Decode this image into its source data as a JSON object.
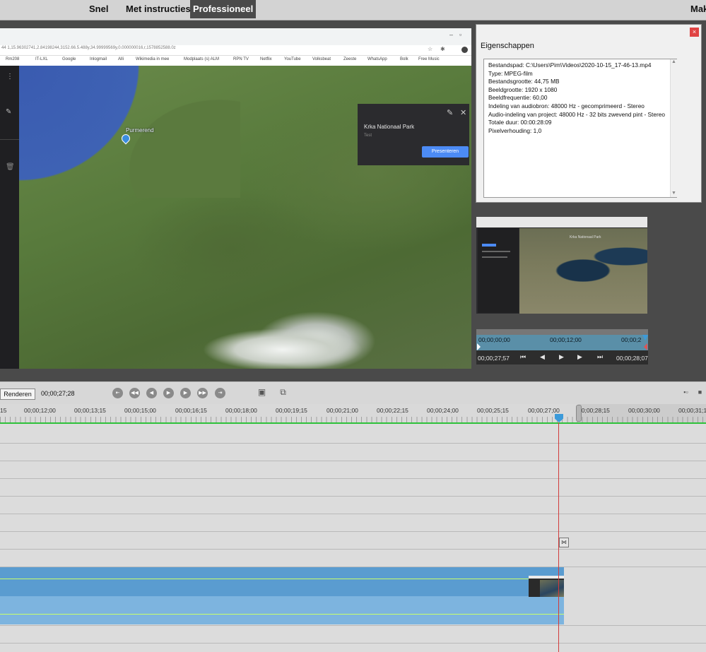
{
  "topbar": {
    "modes": [
      "Snel",
      "Met instructies",
      "Professioneel"
    ],
    "active_mode": "Professioneel",
    "right_label": "Mak"
  },
  "preview": {
    "address_text": "44 1,15.96302741,2.84198244,3152.66.5.488y,34.99999569y,0.000000016,r,1578852588.0z",
    "bookmarks": [
      "Rm208",
      "IT-LXL",
      "Google",
      "Inlogmail",
      "Alli",
      "Wikimedia in mee",
      "Modplaats (s) ALM",
      "RPN TV",
      "Netflix",
      "YouTube",
      "Volksbeat",
      "Zeeste",
      "WhatsApp",
      "Bolk",
      "Free Music"
    ],
    "pin_label": "Purmerend",
    "card": {
      "title": "Krka Nationaal Park",
      "subtitle": "Test",
      "button_label": "Presenteren"
    }
  },
  "properties": {
    "title": "Eigenschappen",
    "close_symbol": "×",
    "lines": [
      "Bestandspad: C:\\Users\\Pim\\Videos\\2020-10-15_17-46-13.mp4",
      "Type: MPEG-film",
      "Bestandsgrootte: 44,75 MB",
      "Beeldgrootte: 1920 x 1080",
      "Beeldfrequentie: 60,00",
      "Indeling van audiobron: 48000  Hz - gecomprimeerd - Stereo",
      "Audio-indeling van project: 48000  Hz - 32 bits zwevend pint - Stereo",
      "Totale duur: 00:00:28:09",
      "Pixelverhouding: 1,0"
    ]
  },
  "monitor": {
    "map_title": "Krka Nationaal Park",
    "scrub_start": "00;00;00;00",
    "scrub_mid": "00;00;12;00",
    "scrub_end": "00;00;2",
    "current_tc": "00;00;27;57",
    "end_tc": "00;00;28;07"
  },
  "transport": {
    "render_label": "Renderen",
    "current_tc": "00;00;27;28"
  },
  "ruler": {
    "labels": [
      "15",
      "00;00;12;00",
      "00;00;13;15",
      "00;00;15;00",
      "00;00;16;15",
      "00;00;18;00",
      "00;00;19;15",
      "00;00;21;00",
      "00;00;22;15",
      "00;00;24;00",
      "00;00;25;15",
      "00;00;27;00",
      "00;00;28;15",
      "00;00;30;00",
      "00;00;31;1"
    ]
  },
  "timeline": {
    "trim_symbol": "⋈"
  },
  "colors": {
    "accent": "#3c9ad9",
    "playhead": "#d23a3a",
    "clip": "#5b9fd3",
    "green_line": "#2ec23a"
  }
}
